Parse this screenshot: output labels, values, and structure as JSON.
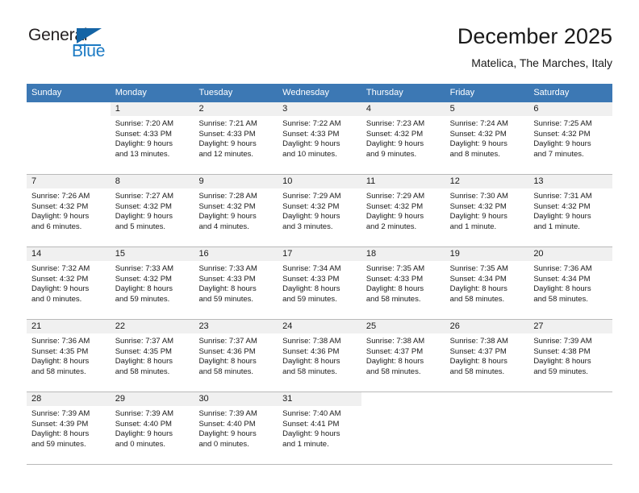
{
  "brand": {
    "name_part1": "General",
    "name_part2": "Blue",
    "triangle_color": "#1464a5",
    "blue_color": "#1b7ac4"
  },
  "header": {
    "title": "December 2025",
    "subtitle": "Matelica, The Marches, Italy",
    "weekday_header_bg": "#3c78b4"
  },
  "weekdays": [
    "Sunday",
    "Monday",
    "Tuesday",
    "Wednesday",
    "Thursday",
    "Friday",
    "Saturday"
  ],
  "weeks": [
    [
      {
        "empty": true,
        "day": "",
        "sunrise": "",
        "sunset": "",
        "daylight1": "",
        "daylight2": ""
      },
      {
        "empty": false,
        "day": "1",
        "sunrise": "Sunrise: 7:20 AM",
        "sunset": "Sunset: 4:33 PM",
        "daylight1": "Daylight: 9 hours",
        "daylight2": "and 13 minutes."
      },
      {
        "empty": false,
        "day": "2",
        "sunrise": "Sunrise: 7:21 AM",
        "sunset": "Sunset: 4:33 PM",
        "daylight1": "Daylight: 9 hours",
        "daylight2": "and 12 minutes."
      },
      {
        "empty": false,
        "day": "3",
        "sunrise": "Sunrise: 7:22 AM",
        "sunset": "Sunset: 4:33 PM",
        "daylight1": "Daylight: 9 hours",
        "daylight2": "and 10 minutes."
      },
      {
        "empty": false,
        "day": "4",
        "sunrise": "Sunrise: 7:23 AM",
        "sunset": "Sunset: 4:32 PM",
        "daylight1": "Daylight: 9 hours",
        "daylight2": "and 9 minutes."
      },
      {
        "empty": false,
        "day": "5",
        "sunrise": "Sunrise: 7:24 AM",
        "sunset": "Sunset: 4:32 PM",
        "daylight1": "Daylight: 9 hours",
        "daylight2": "and 8 minutes."
      },
      {
        "empty": false,
        "day": "6",
        "sunrise": "Sunrise: 7:25 AM",
        "sunset": "Sunset: 4:32 PM",
        "daylight1": "Daylight: 9 hours",
        "daylight2": "and 7 minutes."
      }
    ],
    [
      {
        "empty": false,
        "day": "7",
        "sunrise": "Sunrise: 7:26 AM",
        "sunset": "Sunset: 4:32 PM",
        "daylight1": "Daylight: 9 hours",
        "daylight2": "and 6 minutes."
      },
      {
        "empty": false,
        "day": "8",
        "sunrise": "Sunrise: 7:27 AM",
        "sunset": "Sunset: 4:32 PM",
        "daylight1": "Daylight: 9 hours",
        "daylight2": "and 5 minutes."
      },
      {
        "empty": false,
        "day": "9",
        "sunrise": "Sunrise: 7:28 AM",
        "sunset": "Sunset: 4:32 PM",
        "daylight1": "Daylight: 9 hours",
        "daylight2": "and 4 minutes."
      },
      {
        "empty": false,
        "day": "10",
        "sunrise": "Sunrise: 7:29 AM",
        "sunset": "Sunset: 4:32 PM",
        "daylight1": "Daylight: 9 hours",
        "daylight2": "and 3 minutes."
      },
      {
        "empty": false,
        "day": "11",
        "sunrise": "Sunrise: 7:29 AM",
        "sunset": "Sunset: 4:32 PM",
        "daylight1": "Daylight: 9 hours",
        "daylight2": "and 2 minutes."
      },
      {
        "empty": false,
        "day": "12",
        "sunrise": "Sunrise: 7:30 AM",
        "sunset": "Sunset: 4:32 PM",
        "daylight1": "Daylight: 9 hours",
        "daylight2": "and 1 minute."
      },
      {
        "empty": false,
        "day": "13",
        "sunrise": "Sunrise: 7:31 AM",
        "sunset": "Sunset: 4:32 PM",
        "daylight1": "Daylight: 9 hours",
        "daylight2": "and 1 minute."
      }
    ],
    [
      {
        "empty": false,
        "day": "14",
        "sunrise": "Sunrise: 7:32 AM",
        "sunset": "Sunset: 4:32 PM",
        "daylight1": "Daylight: 9 hours",
        "daylight2": "and 0 minutes."
      },
      {
        "empty": false,
        "day": "15",
        "sunrise": "Sunrise: 7:33 AM",
        "sunset": "Sunset: 4:32 PM",
        "daylight1": "Daylight: 8 hours",
        "daylight2": "and 59 minutes."
      },
      {
        "empty": false,
        "day": "16",
        "sunrise": "Sunrise: 7:33 AM",
        "sunset": "Sunset: 4:33 PM",
        "daylight1": "Daylight: 8 hours",
        "daylight2": "and 59 minutes."
      },
      {
        "empty": false,
        "day": "17",
        "sunrise": "Sunrise: 7:34 AM",
        "sunset": "Sunset: 4:33 PM",
        "daylight1": "Daylight: 8 hours",
        "daylight2": "and 59 minutes."
      },
      {
        "empty": false,
        "day": "18",
        "sunrise": "Sunrise: 7:35 AM",
        "sunset": "Sunset: 4:33 PM",
        "daylight1": "Daylight: 8 hours",
        "daylight2": "and 58 minutes."
      },
      {
        "empty": false,
        "day": "19",
        "sunrise": "Sunrise: 7:35 AM",
        "sunset": "Sunset: 4:34 PM",
        "daylight1": "Daylight: 8 hours",
        "daylight2": "and 58 minutes."
      },
      {
        "empty": false,
        "day": "20",
        "sunrise": "Sunrise: 7:36 AM",
        "sunset": "Sunset: 4:34 PM",
        "daylight1": "Daylight: 8 hours",
        "daylight2": "and 58 minutes."
      }
    ],
    [
      {
        "empty": false,
        "day": "21",
        "sunrise": "Sunrise: 7:36 AM",
        "sunset": "Sunset: 4:35 PM",
        "daylight1": "Daylight: 8 hours",
        "daylight2": "and 58 minutes."
      },
      {
        "empty": false,
        "day": "22",
        "sunrise": "Sunrise: 7:37 AM",
        "sunset": "Sunset: 4:35 PM",
        "daylight1": "Daylight: 8 hours",
        "daylight2": "and 58 minutes."
      },
      {
        "empty": false,
        "day": "23",
        "sunrise": "Sunrise: 7:37 AM",
        "sunset": "Sunset: 4:36 PM",
        "daylight1": "Daylight: 8 hours",
        "daylight2": "and 58 minutes."
      },
      {
        "empty": false,
        "day": "24",
        "sunrise": "Sunrise: 7:38 AM",
        "sunset": "Sunset: 4:36 PM",
        "daylight1": "Daylight: 8 hours",
        "daylight2": "and 58 minutes."
      },
      {
        "empty": false,
        "day": "25",
        "sunrise": "Sunrise: 7:38 AM",
        "sunset": "Sunset: 4:37 PM",
        "daylight1": "Daylight: 8 hours",
        "daylight2": "and 58 minutes."
      },
      {
        "empty": false,
        "day": "26",
        "sunrise": "Sunrise: 7:38 AM",
        "sunset": "Sunset: 4:37 PM",
        "daylight1": "Daylight: 8 hours",
        "daylight2": "and 58 minutes."
      },
      {
        "empty": false,
        "day": "27",
        "sunrise": "Sunrise: 7:39 AM",
        "sunset": "Sunset: 4:38 PM",
        "daylight1": "Daylight: 8 hours",
        "daylight2": "and 59 minutes."
      }
    ],
    [
      {
        "empty": false,
        "day": "28",
        "sunrise": "Sunrise: 7:39 AM",
        "sunset": "Sunset: 4:39 PM",
        "daylight1": "Daylight: 8 hours",
        "daylight2": "and 59 minutes."
      },
      {
        "empty": false,
        "day": "29",
        "sunrise": "Sunrise: 7:39 AM",
        "sunset": "Sunset: 4:40 PM",
        "daylight1": "Daylight: 9 hours",
        "daylight2": "and 0 minutes."
      },
      {
        "empty": false,
        "day": "30",
        "sunrise": "Sunrise: 7:39 AM",
        "sunset": "Sunset: 4:40 PM",
        "daylight1": "Daylight: 9 hours",
        "daylight2": "and 0 minutes."
      },
      {
        "empty": false,
        "day": "31",
        "sunrise": "Sunrise: 7:40 AM",
        "sunset": "Sunset: 4:41 PM",
        "daylight1": "Daylight: 9 hours",
        "daylight2": "and 1 minute."
      },
      {
        "empty": true,
        "day": "",
        "sunrise": "",
        "sunset": "",
        "daylight1": "",
        "daylight2": ""
      },
      {
        "empty": true,
        "day": "",
        "sunrise": "",
        "sunset": "",
        "daylight1": "",
        "daylight2": ""
      },
      {
        "empty": true,
        "day": "",
        "sunrise": "",
        "sunset": "",
        "daylight1": "",
        "daylight2": ""
      }
    ]
  ]
}
